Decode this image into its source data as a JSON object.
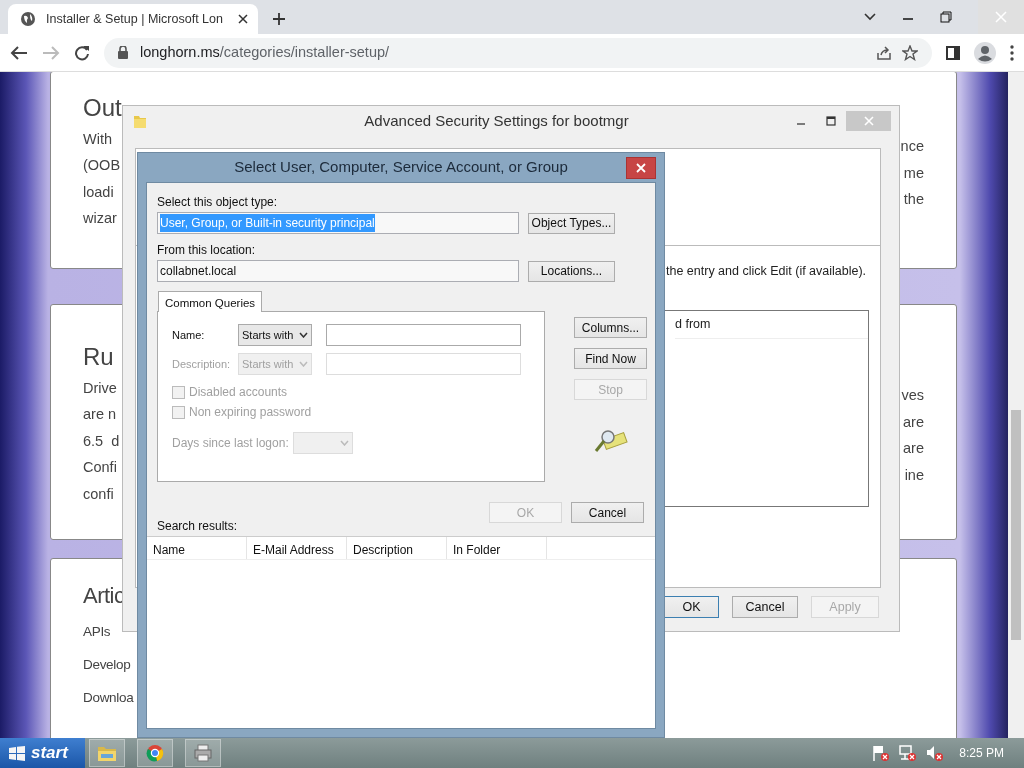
{
  "browser": {
    "tab_title": "Installer & Setup | Microsoft Lon",
    "url_host": "longhorn.ms",
    "url_path": "/categories/installer-setup/"
  },
  "page": {
    "cards": [
      {
        "heading": "Out",
        "left_lines": [
          "With",
          "(OOB",
          "loadi",
          "wizar"
        ],
        "right_lines": [
          "nce",
          "me",
          "the"
        ]
      },
      {
        "heading": "Ru",
        "left_lines": [
          "Drive",
          "are n",
          "6.5  d",
          "Confi",
          "confi"
        ],
        "right_lines": [
          "ves",
          "are",
          "are",
          "ine"
        ]
      },
      {
        "heading": "Artic",
        "left_lines": [
          "APIs",
          "Develop",
          "Downloa"
        ]
      }
    ]
  },
  "security_window": {
    "title": "Advanced Security Settings for bootmgr",
    "hint": "the entry and click Edit (if available).",
    "list_column": "d from",
    "buttons": [
      {
        "label": "OK",
        "disabled": false,
        "default": true
      },
      {
        "label": "Cancel",
        "disabled": false,
        "default": false
      },
      {
        "label": "Apply",
        "disabled": true,
        "default": false
      }
    ]
  },
  "dialog": {
    "title": "Select User, Computer, Service Account, or Group",
    "object_type": {
      "label": "Select this object type:",
      "value": "User, Group, or Built-in security principal",
      "selected": true,
      "button": "Object Types..."
    },
    "location": {
      "label": "From this location:",
      "value": "collabnet.local",
      "button": "Locations..."
    },
    "tabs": [
      {
        "label": "Common Queries",
        "selected": true
      }
    ],
    "queries": [
      {
        "kind": "text",
        "label": "Name:",
        "operator": "Starts with",
        "disabled": false
      },
      {
        "kind": "text",
        "label": "Description:",
        "operator": "Starts with",
        "disabled": true
      },
      {
        "kind": "checkbox",
        "label": "Disabled accounts",
        "checked": false,
        "disabled": true
      },
      {
        "kind": "checkbox",
        "label": "Non expiring password",
        "checked": false,
        "disabled": true
      },
      {
        "kind": "days",
        "label": "Days since last logon:",
        "disabled": true
      }
    ],
    "side_buttons": [
      {
        "label": "Columns...",
        "disabled": false
      },
      {
        "label": "Find Now",
        "disabled": false
      },
      {
        "label": "Stop",
        "disabled": true
      }
    ],
    "ok_button": {
      "label": "OK",
      "disabled": true
    },
    "cancel_button": {
      "label": "Cancel",
      "disabled": false
    },
    "results_label": "Search results:",
    "results_columns": [
      "Name",
      "E-Mail Address",
      "Description",
      "In Folder"
    ]
  },
  "taskbar": {
    "start_label": "start",
    "clock": "8:25 PM"
  }
}
